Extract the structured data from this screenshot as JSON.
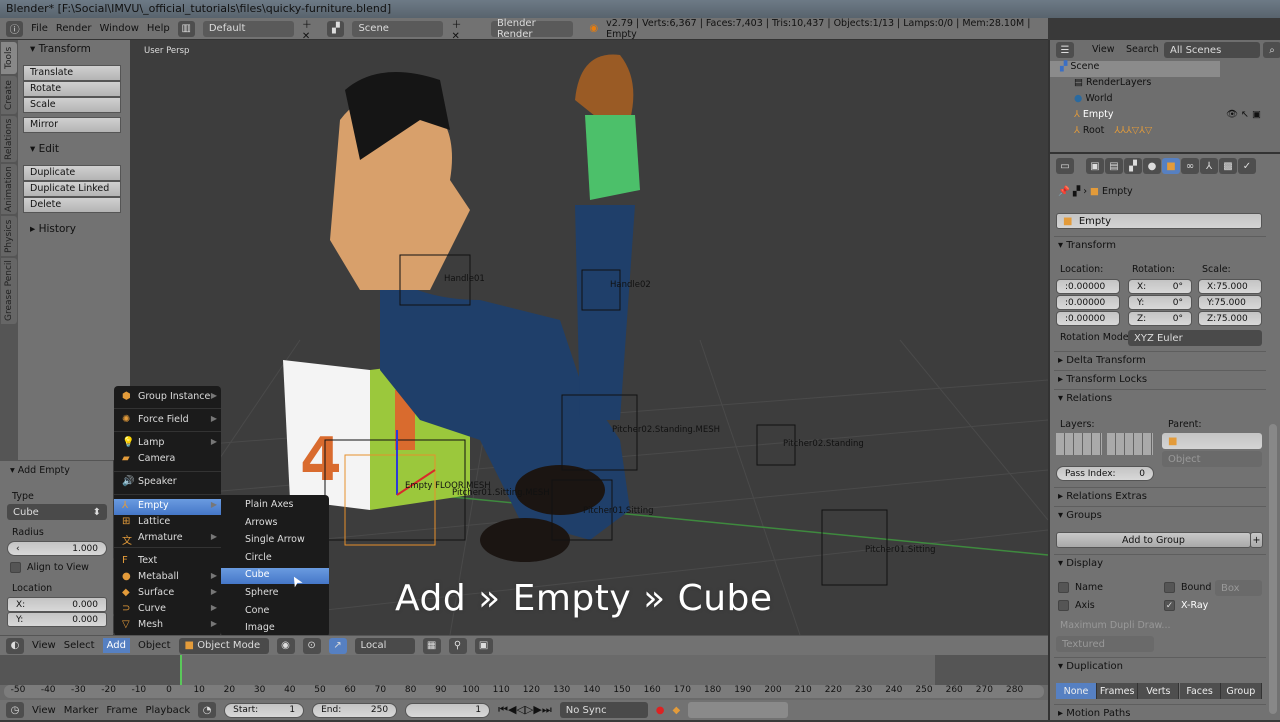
{
  "window_title": "Blender* [F:\\Social\\IMVU\\_official_tutorials\\files\\quicky-furniture.blend]",
  "info": {
    "menus": [
      "File",
      "Render",
      "Window",
      "Help"
    ],
    "screen": "Default",
    "scene": "Scene",
    "engine": "Blender Render",
    "stats": "v2.79 | Verts:6,367 | Faces:7,403 | Tris:10,437 | Objects:1/13 | Lamps:0/0 | Mem:28.10M | Empty"
  },
  "viewport": {
    "label": "User Persp",
    "caption": "Add » Empty » Cube",
    "object_labels": [
      "Handle01",
      "Handle02",
      "Pitcher02.Standing",
      "Pitcher01.Sitting",
      "Pitcher01.Sitting",
      "Empty FLOOR.MESH",
      "Pitcher01.Sitting.MESH",
      "Pitcher02.Standing.MESH"
    ]
  },
  "tool_tabs": [
    "Tools",
    "Create",
    "Relations",
    "Animation",
    "Physics",
    "Grease Pencil"
  ],
  "toolshelf": {
    "transform_title": "Transform",
    "transform_buttons": [
      "Translate",
      "Rotate",
      "Scale"
    ],
    "mirror": "Mirror",
    "edit_title": "Edit",
    "edit_buttons": [
      "Duplicate",
      "Duplicate Linked",
      "Delete"
    ],
    "history": "History"
  },
  "add_empty": {
    "title": "Add Empty",
    "type_label": "Type",
    "type_value": "Cube",
    "radius_label": "Radius",
    "radius_value": "1.000",
    "align_label": "Align to View",
    "location_label": "Location",
    "x_label": "X:",
    "x_value": "0.000",
    "y_label": "Y:",
    "y_value": "0.000"
  },
  "add_menu": {
    "items": [
      {
        "label": "Group Instance",
        "icon": "group-instance-icon",
        "sub": true
      },
      {
        "label": "Force Field",
        "icon": "force-field-icon",
        "sub": true
      },
      {
        "label": "Lamp",
        "icon": "lamp-icon",
        "sub": true
      },
      {
        "label": "Camera",
        "icon": "camera-icon",
        "sub": false
      },
      {
        "label": "Speaker",
        "icon": "speaker-icon",
        "sub": false
      },
      {
        "label": "Empty",
        "icon": "empty-icon",
        "sub": true
      },
      {
        "label": "Lattice",
        "icon": "lattice-icon",
        "sub": false
      },
      {
        "label": "Armature",
        "icon": "armature-icon",
        "sub": true
      },
      {
        "label": "Text",
        "icon": "text-icon",
        "sub": false
      },
      {
        "label": "Metaball",
        "icon": "metaball-icon",
        "sub": true
      },
      {
        "label": "Surface",
        "icon": "surface-icon",
        "sub": true
      },
      {
        "label": "Curve",
        "icon": "curve-icon",
        "sub": true
      },
      {
        "label": "Mesh",
        "icon": "mesh-icon",
        "sub": true
      }
    ],
    "empty_submenu": [
      "Plain Axes",
      "Arrows",
      "Single Arrow",
      "Circle",
      "Cube",
      "Sphere",
      "Cone",
      "Image"
    ],
    "highlighted": "Cube"
  },
  "view3d_header": {
    "menus": [
      "View",
      "Select",
      "Add",
      "Object"
    ],
    "active_menu": "Add",
    "mode": "Object Mode",
    "orientation": "Local"
  },
  "timeline": {
    "ticks": [
      "-50",
      "-40",
      "-30",
      "-20",
      "-10",
      "0",
      "10",
      "20",
      "30",
      "40",
      "50",
      "60",
      "70",
      "80",
      "90",
      "100",
      "110",
      "120",
      "130",
      "140",
      "150",
      "160",
      "170",
      "180",
      "190",
      "200",
      "210",
      "220",
      "230",
      "240",
      "250",
      "260",
      "270",
      "280"
    ],
    "current_frame": 1,
    "menus": [
      "View",
      "Marker",
      "Frame",
      "Playback"
    ],
    "start_label": "Start:",
    "start": "1",
    "end_label": "End:",
    "end": "250",
    "frame": "1",
    "sync": "No Sync"
  },
  "outliner": {
    "menus": [
      "View",
      "Search"
    ],
    "filter": "All Scenes",
    "rows": [
      "Scene",
      "RenderLayers",
      "World",
      "Empty",
      "Root"
    ]
  },
  "properties": {
    "breadcrumb": "Empty",
    "object_name": "Empty",
    "transform": "Transform",
    "location_label": "Location:",
    "rotation_label": "Rotation:",
    "scale_label": "Scale:",
    "location": [
      ":0.00000",
      ":0.00000",
      ":0.00000"
    ],
    "rotation": [
      [
        "X:",
        "0°"
      ],
      [
        "Y:",
        "0°"
      ],
      [
        "Z:",
        "0°"
      ]
    ],
    "scale": [
      "X:75.000",
      "Y:75.000",
      "Z:75.000"
    ],
    "rotation_mode_label": "Rotation Mode:",
    "rotation_mode": "XYZ Euler",
    "delta_transform": "Delta Transform",
    "transform_locks": "Transform Locks",
    "relations": "Relations",
    "layers_label": "Layers:",
    "parent_label": "Parent:",
    "parent_type": "Object",
    "pass_index_label": "Pass Index:",
    "pass_index": "0",
    "relations_extras": "Relations Extras",
    "groups": "Groups",
    "add_to_group": "Add to Group",
    "display": "Display",
    "name_label": "Name",
    "axis_label": "Axis",
    "bound_label": "Bound",
    "bound_type": "Box",
    "xray_label": "X-Ray",
    "max_dupli": "Maximum Dupli Draw...",
    "draw_type": "Textured",
    "duplication": "Duplication",
    "dup_options": [
      "None",
      "Frames",
      "Verts",
      "Faces",
      "Group"
    ],
    "dup_active": "None",
    "motion_paths": "Motion Paths"
  },
  "colors": {
    "highlight": "#5680c2",
    "panel": "#727272",
    "menu_bg": "#1b1b1b",
    "accent_orange": "#e39b3a"
  }
}
